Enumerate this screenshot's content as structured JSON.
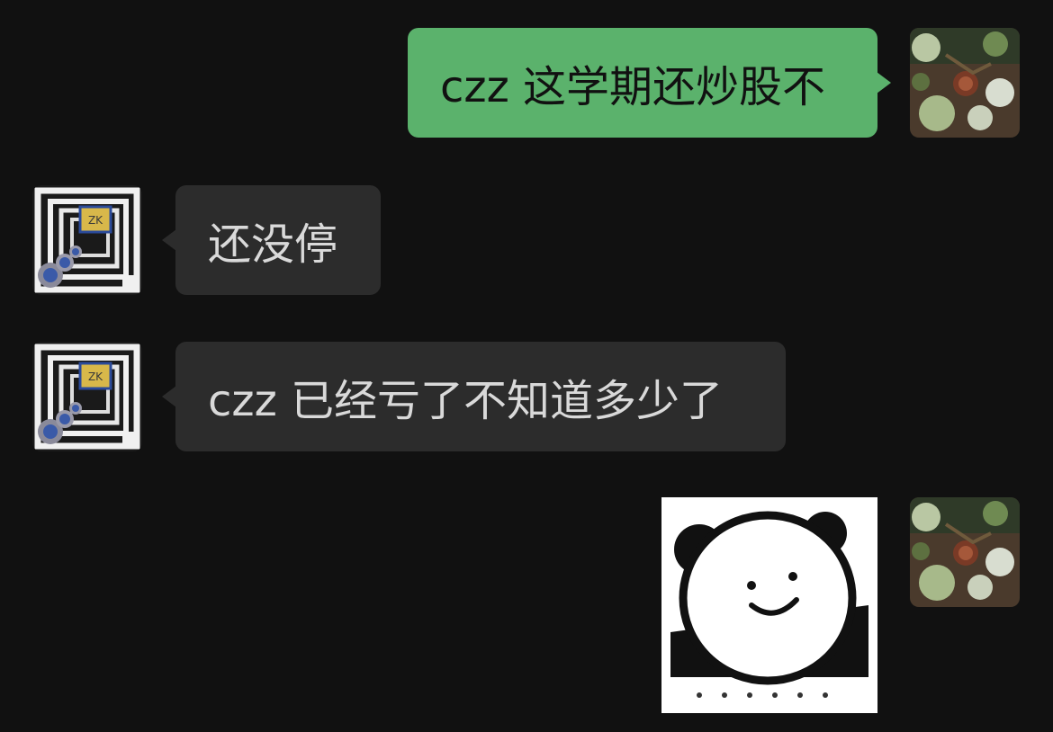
{
  "messages": [
    {
      "direction": "outgoing",
      "type": "text",
      "text": "czz 这学期还炒股不",
      "avatar": "flowers-teacup-avatar"
    },
    {
      "direction": "incoming",
      "type": "text",
      "text": "还没停",
      "avatar": "square-tunnel-logo-avatar"
    },
    {
      "direction": "incoming",
      "type": "text",
      "text": "czz 已经亏了不知道多少了",
      "avatar": "square-tunnel-logo-avatar"
    },
    {
      "direction": "outgoing",
      "type": "sticker",
      "sticker": "smiling-panda-sticker",
      "avatar": "flowers-teacup-avatar"
    }
  ],
  "colors": {
    "background": "#111111",
    "outgoing_bubble": "#5bb26c",
    "incoming_bubble": "#2c2c2c",
    "incoming_text": "#d9d9d9",
    "outgoing_text": "#111111"
  }
}
